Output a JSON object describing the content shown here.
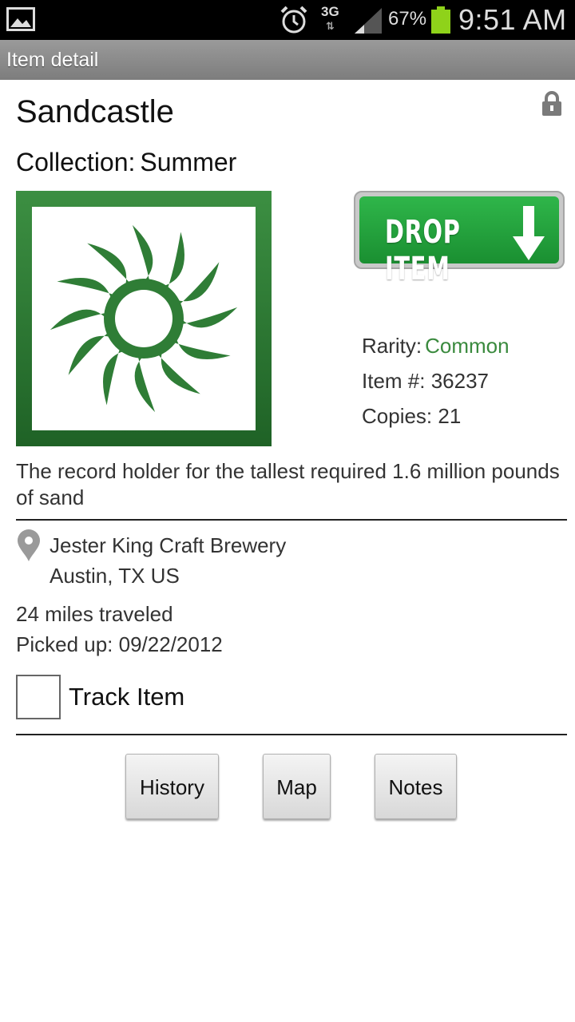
{
  "status_bar": {
    "network": "3G",
    "battery_percent": "67%",
    "time": "9:51 AM",
    "battery_color": "#8fd21a"
  },
  "app_bar": {
    "title": "Item detail"
  },
  "item": {
    "name": "Sandcastle",
    "collection_label": "Collection:",
    "collection_value": "Summer",
    "icon": "sun-icon",
    "rarity_label": "Rarity:",
    "rarity_value": "Common",
    "item_number_label": "Item #:",
    "item_number_value": "36237",
    "copies_label": "Copies:",
    "copies_value": "21",
    "description": "The record holder for the tallest required 1.6 million pounds of sand"
  },
  "actions": {
    "drop_label": "DROP ITEM"
  },
  "location": {
    "place": "Jester King Craft Brewery",
    "city": "Austin, TX  US"
  },
  "travel": {
    "miles": "24 miles traveled",
    "picked_up": "Picked up: 09/22/2012"
  },
  "track": {
    "label": "Track Item",
    "checked": false
  },
  "buttons": {
    "history": "History",
    "map": "Map",
    "notes": "Notes"
  },
  "colors": {
    "accent_green": "#3a8a3e",
    "drop_button_green": "#22a53d"
  }
}
